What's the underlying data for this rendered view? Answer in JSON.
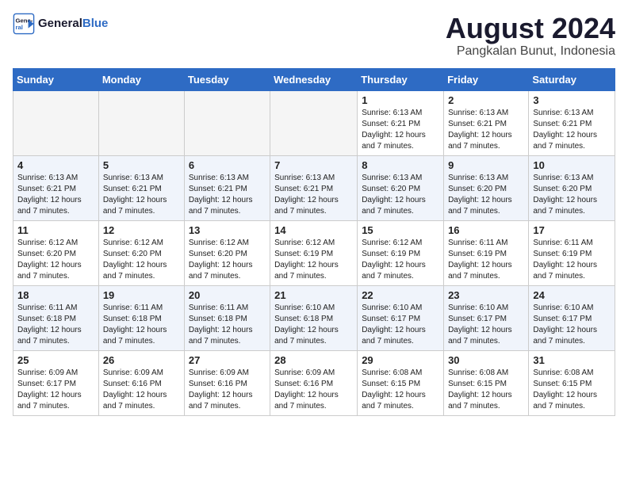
{
  "header": {
    "logo_line1": "General",
    "logo_line2": "Blue",
    "month_year": "August 2024",
    "location": "Pangkalan Bunut, Indonesia"
  },
  "weekdays": [
    "Sunday",
    "Monday",
    "Tuesday",
    "Wednesday",
    "Thursday",
    "Friday",
    "Saturday"
  ],
  "weeks": [
    [
      {
        "day": "",
        "info": ""
      },
      {
        "day": "",
        "info": ""
      },
      {
        "day": "",
        "info": ""
      },
      {
        "day": "",
        "info": ""
      },
      {
        "day": "1",
        "info": "Sunrise: 6:13 AM\nSunset: 6:21 PM\nDaylight: 12 hours and 7 minutes."
      },
      {
        "day": "2",
        "info": "Sunrise: 6:13 AM\nSunset: 6:21 PM\nDaylight: 12 hours and 7 minutes."
      },
      {
        "day": "3",
        "info": "Sunrise: 6:13 AM\nSunset: 6:21 PM\nDaylight: 12 hours and 7 minutes."
      }
    ],
    [
      {
        "day": "4",
        "info": "Sunrise: 6:13 AM\nSunset: 6:21 PM\nDaylight: 12 hours and 7 minutes."
      },
      {
        "day": "5",
        "info": "Sunrise: 6:13 AM\nSunset: 6:21 PM\nDaylight: 12 hours and 7 minutes."
      },
      {
        "day": "6",
        "info": "Sunrise: 6:13 AM\nSunset: 6:21 PM\nDaylight: 12 hours and 7 minutes."
      },
      {
        "day": "7",
        "info": "Sunrise: 6:13 AM\nSunset: 6:21 PM\nDaylight: 12 hours and 7 minutes."
      },
      {
        "day": "8",
        "info": "Sunrise: 6:13 AM\nSunset: 6:20 PM\nDaylight: 12 hours and 7 minutes."
      },
      {
        "day": "9",
        "info": "Sunrise: 6:13 AM\nSunset: 6:20 PM\nDaylight: 12 hours and 7 minutes."
      },
      {
        "day": "10",
        "info": "Sunrise: 6:13 AM\nSunset: 6:20 PM\nDaylight: 12 hours and 7 minutes."
      }
    ],
    [
      {
        "day": "11",
        "info": "Sunrise: 6:12 AM\nSunset: 6:20 PM\nDaylight: 12 hours and 7 minutes."
      },
      {
        "day": "12",
        "info": "Sunrise: 6:12 AM\nSunset: 6:20 PM\nDaylight: 12 hours and 7 minutes."
      },
      {
        "day": "13",
        "info": "Sunrise: 6:12 AM\nSunset: 6:20 PM\nDaylight: 12 hours and 7 minutes."
      },
      {
        "day": "14",
        "info": "Sunrise: 6:12 AM\nSunset: 6:19 PM\nDaylight: 12 hours and 7 minutes."
      },
      {
        "day": "15",
        "info": "Sunrise: 6:12 AM\nSunset: 6:19 PM\nDaylight: 12 hours and 7 minutes."
      },
      {
        "day": "16",
        "info": "Sunrise: 6:11 AM\nSunset: 6:19 PM\nDaylight: 12 hours and 7 minutes."
      },
      {
        "day": "17",
        "info": "Sunrise: 6:11 AM\nSunset: 6:19 PM\nDaylight: 12 hours and 7 minutes."
      }
    ],
    [
      {
        "day": "18",
        "info": "Sunrise: 6:11 AM\nSunset: 6:18 PM\nDaylight: 12 hours and 7 minutes."
      },
      {
        "day": "19",
        "info": "Sunrise: 6:11 AM\nSunset: 6:18 PM\nDaylight: 12 hours and 7 minutes."
      },
      {
        "day": "20",
        "info": "Sunrise: 6:11 AM\nSunset: 6:18 PM\nDaylight: 12 hours and 7 minutes."
      },
      {
        "day": "21",
        "info": "Sunrise: 6:10 AM\nSunset: 6:18 PM\nDaylight: 12 hours and 7 minutes."
      },
      {
        "day": "22",
        "info": "Sunrise: 6:10 AM\nSunset: 6:17 PM\nDaylight: 12 hours and 7 minutes."
      },
      {
        "day": "23",
        "info": "Sunrise: 6:10 AM\nSunset: 6:17 PM\nDaylight: 12 hours and 7 minutes."
      },
      {
        "day": "24",
        "info": "Sunrise: 6:10 AM\nSunset: 6:17 PM\nDaylight: 12 hours and 7 minutes."
      }
    ],
    [
      {
        "day": "25",
        "info": "Sunrise: 6:09 AM\nSunset: 6:17 PM\nDaylight: 12 hours and 7 minutes."
      },
      {
        "day": "26",
        "info": "Sunrise: 6:09 AM\nSunset: 6:16 PM\nDaylight: 12 hours and 7 minutes."
      },
      {
        "day": "27",
        "info": "Sunrise: 6:09 AM\nSunset: 6:16 PM\nDaylight: 12 hours and 7 minutes."
      },
      {
        "day": "28",
        "info": "Sunrise: 6:09 AM\nSunset: 6:16 PM\nDaylight: 12 hours and 7 minutes."
      },
      {
        "day": "29",
        "info": "Sunrise: 6:08 AM\nSunset: 6:15 PM\nDaylight: 12 hours and 7 minutes."
      },
      {
        "day": "30",
        "info": "Sunrise: 6:08 AM\nSunset: 6:15 PM\nDaylight: 12 hours and 7 minutes."
      },
      {
        "day": "31",
        "info": "Sunrise: 6:08 AM\nSunset: 6:15 PM\nDaylight: 12 hours and 7 minutes."
      }
    ]
  ]
}
